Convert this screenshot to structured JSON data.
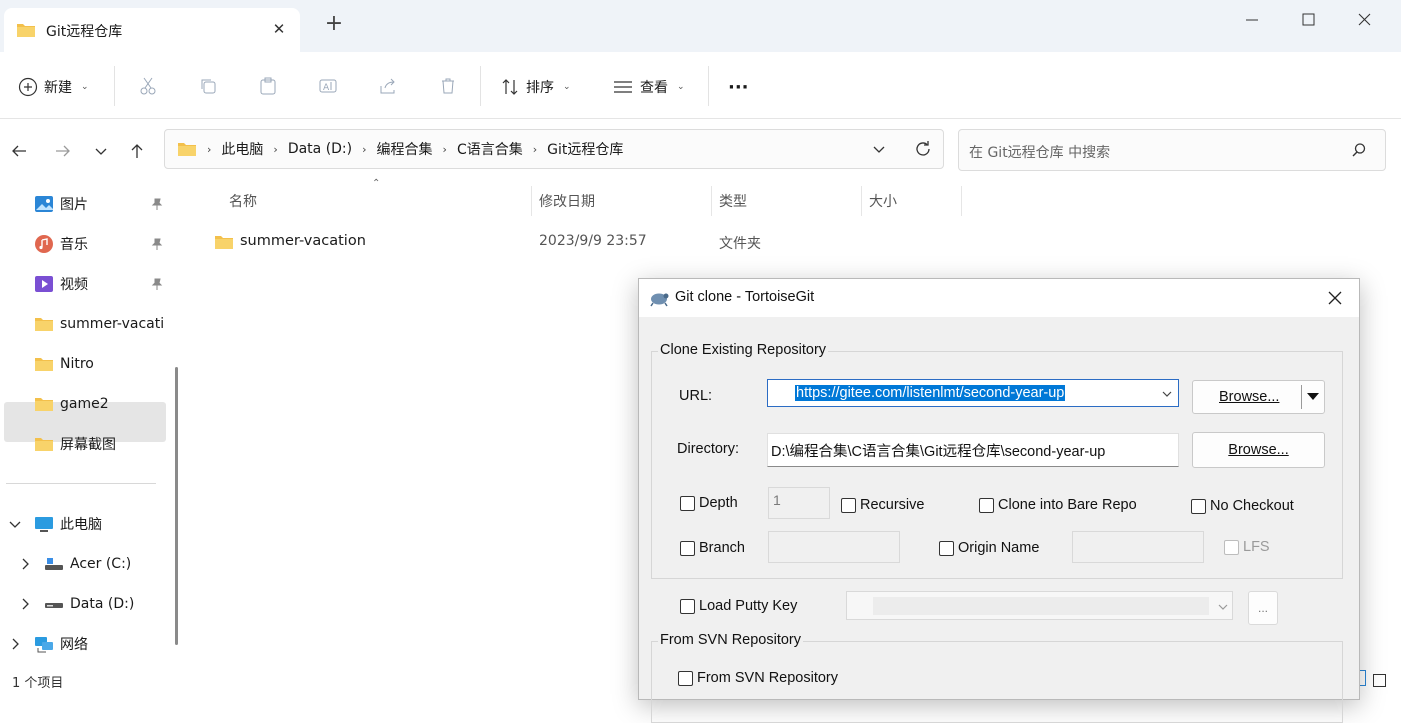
{
  "window": {
    "tab_title": "Git远程仓库",
    "new_tab": "+"
  },
  "toolbar": {
    "new_label": "新建",
    "sort_label": "排序",
    "view_label": "查看",
    "more_label": "···"
  },
  "address": {
    "crumbs": [
      "此电脑",
      "Data (D:)",
      "编程合集",
      "C语言合集",
      "Git远程仓库"
    ],
    "search_placeholder": "在 Git远程仓库 中搜索"
  },
  "sidebar": {
    "items": [
      {
        "label": "图片",
        "icon": "pictures-icon",
        "pinned": true
      },
      {
        "label": "音乐",
        "icon": "music-icon",
        "pinned": true
      },
      {
        "label": "视频",
        "icon": "videos-icon",
        "pinned": true
      },
      {
        "label": "summer-vacati",
        "icon": "folder-icon"
      },
      {
        "label": "Nitro",
        "icon": "folder-icon"
      },
      {
        "label": "game2",
        "icon": "folder-icon"
      },
      {
        "label": "屏幕截图",
        "icon": "folder-icon"
      },
      {
        "label": "此电脑",
        "icon": "this-pc-icon"
      },
      {
        "label": "Acer (C:)",
        "icon": "drive-icon"
      },
      {
        "label": "Data (D:)",
        "icon": "drive-icon",
        "selected": true
      },
      {
        "label": "网络",
        "icon": "network-icon"
      }
    ]
  },
  "columns": {
    "name": "名称",
    "modified": "修改日期",
    "type": "类型",
    "size": "大小"
  },
  "files": [
    {
      "name": "summer-vacation",
      "modified": "2023/9/9 23:57",
      "type": "文件夹",
      "size": ""
    }
  ],
  "status": {
    "count": "1 个项目"
  },
  "dialog": {
    "title": "Git clone - TortoiseGit",
    "group_clone": "Clone Existing Repository",
    "url_label": "URL:",
    "url_value": "https://gitee.com/listenlmt/second-year-up",
    "browse1": "Browse...",
    "dir_label": "Directory:",
    "dir_value": "D:\\编程合集\\C语言合集\\Git远程仓库\\second-year-up",
    "browse2": "Browse...",
    "depth_label": "Depth",
    "depth_value": "1",
    "recursive_label": "Recursive",
    "bare_label": "Clone into Bare Repo",
    "nocheckout_label": "No Checkout",
    "branch_label": "Branch",
    "origin_label": "Origin Name",
    "lfs_label": "LFS",
    "putty_label": "Load Putty Key",
    "putty_browse": "...",
    "group_svn": "From SVN Repository",
    "svn_check_label": "From SVN Repository"
  },
  "colors": {
    "folder": "#f3c04b",
    "selection": "#0078d7",
    "titlebar_bg": "#eff3f8"
  }
}
